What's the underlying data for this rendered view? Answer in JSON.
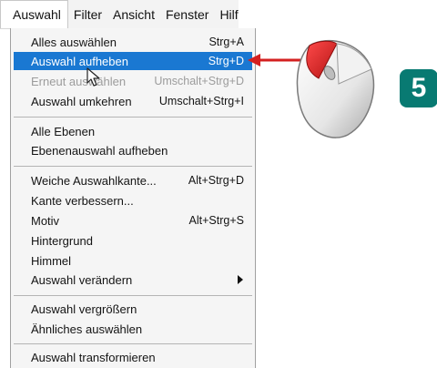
{
  "menubar": {
    "items": [
      "Auswahl",
      "Filter",
      "Ansicht",
      "Fenster",
      "Hilfe"
    ]
  },
  "menu": {
    "items": [
      {
        "label": "Alles auswählen",
        "shortcut": "Strg+A"
      },
      {
        "label": "Auswahl aufheben",
        "shortcut": "Strg+D",
        "state": "highlighted"
      },
      {
        "label": "Erneut auswählen",
        "shortcut": "Umschalt+Strg+D",
        "state": "disabled"
      },
      {
        "label": "Auswahl umkehren",
        "shortcut": "Umschalt+Strg+I"
      },
      {
        "label": "Alle Ebenen",
        "shortcut": ""
      },
      {
        "label": "Ebenenauswahl aufheben",
        "shortcut": ""
      },
      {
        "label": "Weiche Auswahlkante...",
        "shortcut": "Alt+Strg+D"
      },
      {
        "label": "Kante verbessern...",
        "shortcut": ""
      },
      {
        "label": "Motiv",
        "shortcut": "Alt+Strg+S"
      },
      {
        "label": "Hintergrund",
        "shortcut": ""
      },
      {
        "label": "Himmel",
        "shortcut": ""
      },
      {
        "label": "Auswahl verändern",
        "shortcut": "",
        "submenu": true
      },
      {
        "label": "Auswahl vergrößern",
        "shortcut": ""
      },
      {
        "label": "Ähnliches auswählen",
        "shortcut": ""
      },
      {
        "label": "Auswahl transformieren",
        "shortcut": ""
      }
    ]
  },
  "callout": {
    "step_number": "5",
    "step_color": "#087a72",
    "arrow_color": "#d42020",
    "icon": "computer-mouse-icon"
  },
  "colors": {
    "highlight": "#1a78d2",
    "menu_background": "#f5f5f5"
  }
}
